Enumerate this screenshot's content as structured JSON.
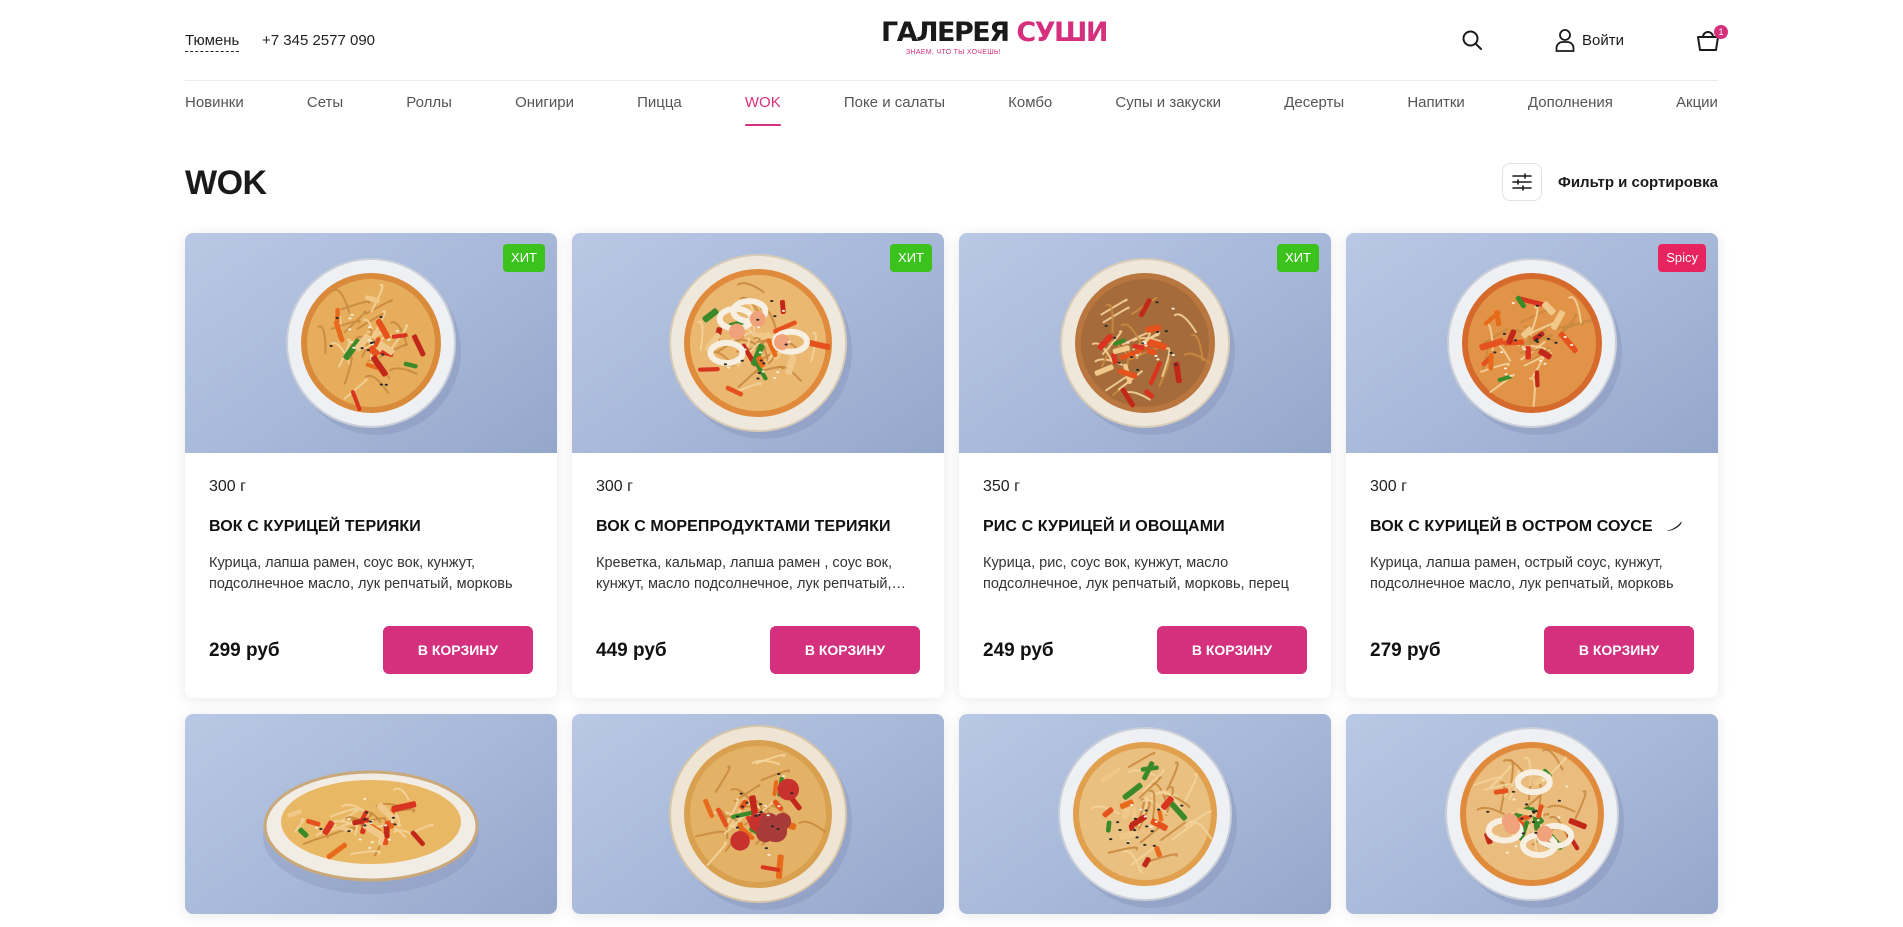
{
  "header": {
    "city": "Тюмень",
    "phone": "+7 345 2577 090",
    "logo_word1": "ГАЛЕРЕЯ",
    "logo_word2": "СУШИ",
    "logo_tagline": "ЗНАЕМ, ЧТО ТЫ ХОЧЕШЬ!",
    "login_label": "Войти",
    "cart_count": "1"
  },
  "nav": {
    "items": [
      "Новинки",
      "Сеты",
      "Роллы",
      "Онигири",
      "Пицца",
      "WOK",
      "Поке и салаты",
      "Комбо",
      "Супы и закуски",
      "Десерты",
      "Напитки",
      "Дополнения",
      "Акции"
    ],
    "active": "WOK"
  },
  "page": {
    "title": "WOK",
    "filter_label": "Фильтр и сортировка"
  },
  "products": [
    {
      "badge": "ХИТ",
      "weight": "300 г",
      "name": "ВОК С КУРИЦЕЙ ТЕРИЯКИ",
      "desc": "Курица, лапша рамен, соус вок, кунжут, подсолнечное масло, лук репчатый, морковь",
      "price": "299 руб",
      "button": "В КОРЗИНУ"
    },
    {
      "badge": "ХИТ",
      "weight": "300 г",
      "name": "ВОК С МОРЕПРОДУКТАМИ ТЕРИЯКИ",
      "desc": "Креветка, кальмар, лапша рамен , соус вок, кунжут, масло подсолнечное, лук репчатый, морковь",
      "price": "449 руб",
      "button": "В КОРЗИНУ"
    },
    {
      "badge": "ХИТ",
      "weight": "350 г",
      "name": "РИС С КУРИЦЕЙ И ОВОЩАМИ",
      "desc": "Курица, рис, соус вок, кунжут, масло подсолнечное, лук репчатый, морковь, перец",
      "price": "249 руб",
      "button": "В КОРЗИНУ"
    },
    {
      "badge": "Spicy",
      "weight": "300 г",
      "name": "ВОК С КУРИЦЕЙ В ОСТРОМ СОУСЕ",
      "desc": "Курица, лапша рамен, острый соус, кунжут, подсолнечное масло, лук репчатый, морковь",
      "price": "279 руб",
      "button": "В КОРЗИНУ"
    }
  ],
  "colors": {
    "accent": "#d4307e",
    "badge_hit": "#3cc21d",
    "badge_spicy": "#e8245f"
  },
  "icons": [
    "search-icon",
    "user-icon",
    "cart-icon",
    "filter-icon",
    "chili-icon"
  ]
}
